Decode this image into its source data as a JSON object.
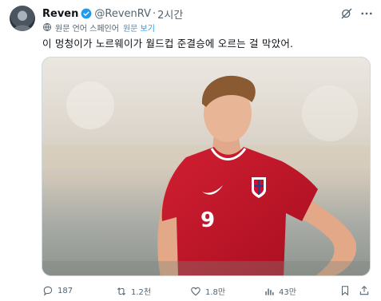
{
  "tweet": {
    "author_name": "Reven",
    "handle": "@RevenRV",
    "separator": "·",
    "time": "2시간",
    "translation_note": "원문 언어 스페인어",
    "show_original": "원문 보기",
    "text": "이 멍청이가 노르웨이가 월드컵 준결승에 오르는 걸 막았어.",
    "media_alt_icon": "photo-player-red-jersey"
  },
  "actions": {
    "replies": "187",
    "reposts": "1.2천",
    "likes": "1.8만",
    "views": "43만"
  },
  "colors": {
    "accent": "#1d9bf0",
    "secondary_text": "#536471",
    "jersey_red": "#c8102e"
  }
}
